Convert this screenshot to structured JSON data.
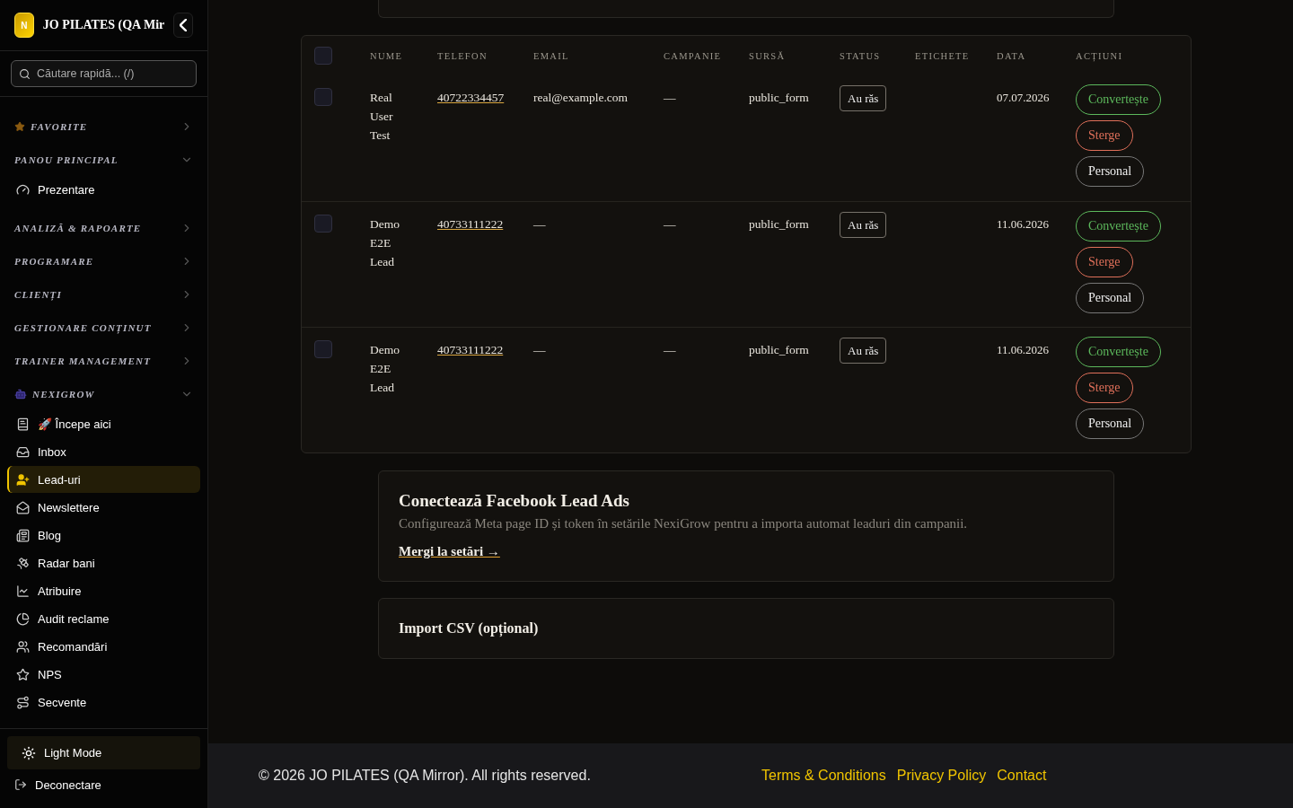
{
  "sidebar": {
    "brand": {
      "logo": "N",
      "title": "JO PILATES (QA Mir"
    },
    "search": {
      "placeholder": "Căutare rapidă... (/)"
    },
    "sections": [
      {
        "label": "FAVORITE",
        "kind": "favorite",
        "expanded": false
      },
      {
        "label": "PANOU PRINCIPAL",
        "kind": "plain",
        "expanded": true,
        "items": [
          {
            "label": "Prezentare",
            "selected": false
          }
        ]
      },
      {
        "label": "ANALIZĂ & RAPOARTE",
        "kind": "plain",
        "expanded": false
      },
      {
        "label": "PROGRAMARE",
        "kind": "plain",
        "expanded": false
      },
      {
        "label": "CLIENȚI",
        "kind": "plain",
        "expanded": false
      },
      {
        "label": "GESTIONARE CONȚINUT",
        "kind": "plain",
        "expanded": false
      },
      {
        "label": "TRAINER MANAGEMENT",
        "kind": "plain",
        "expanded": false
      },
      {
        "label": "NEXIGROW",
        "kind": "robot",
        "expanded": true,
        "items": [
          {
            "label": "🚀 Începe aici",
            "selected": false
          },
          {
            "label": "Inbox",
            "selected": false
          },
          {
            "label": "Lead-uri",
            "selected": true
          },
          {
            "label": "Newslettere",
            "selected": false
          },
          {
            "label": "Blog",
            "selected": false
          },
          {
            "label": "Radar bani",
            "selected": false
          },
          {
            "label": "Atribuire",
            "selected": false
          },
          {
            "label": "Audit reclame",
            "selected": false
          },
          {
            "label": "Recomandări",
            "selected": false
          },
          {
            "label": "NPS",
            "selected": false
          },
          {
            "label": "Secvente",
            "selected": false
          }
        ]
      }
    ],
    "theme_toggle": "Light Mode",
    "logout": "Deconectare"
  },
  "table": {
    "columns": [
      "NUME",
      "TELEFON",
      "EMAIL",
      "CAMPANIE",
      "SURSĂ",
      "STATUS",
      "ETICHETE",
      "DATA",
      "ACȚIUNI"
    ],
    "header_checked": false,
    "rows": [
      {
        "checked": false,
        "name": "Real User Test",
        "phone": "40722334457",
        "email": "real@example.com",
        "campaign": "—",
        "source": "public_form",
        "status": "Au răs",
        "date": "07.07.2026",
        "actions": [
          {
            "label": "Convertește",
            "kind": "convert"
          },
          {
            "label": "Sterge",
            "kind": "delete"
          },
          {
            "label": "Personal",
            "kind": "neutral"
          }
        ]
      },
      {
        "checked": false,
        "name": "Demo E2E Lead",
        "phone": "40733111222",
        "email": "—",
        "campaign": "—",
        "source": "public_form",
        "status": "Au răs",
        "date": "11.06.2026",
        "actions": [
          {
            "label": "Convertește",
            "kind": "convert"
          },
          {
            "label": "Sterge",
            "kind": "delete"
          },
          {
            "label": "Personal",
            "kind": "neutral"
          }
        ]
      },
      {
        "checked": false,
        "name": "Demo E2E Lead",
        "phone": "40733111222",
        "email": "—",
        "campaign": "—",
        "source": "public_form",
        "status": "Au răs",
        "date": "11.06.2026",
        "actions": [
          {
            "label": "Convertește",
            "kind": "convert"
          },
          {
            "label": "Sterge",
            "kind": "delete"
          },
          {
            "label": "Personal",
            "kind": "neutral"
          }
        ]
      }
    ]
  },
  "facebook_card": {
    "title": "Conectează Facebook Lead Ads",
    "text": "Configurează Meta page ID și token în setările NexiGrow pentru a importa automat leaduri din campanii.",
    "link": "Mergi la setări →"
  },
  "csv_card": {
    "title": "Import CSV (opțional)"
  },
  "footer": {
    "copyright": "© 2026 JO PILATES (QA Mirror). All rights reserved.",
    "links": [
      "Terms & Conditions",
      "Privacy Policy",
      "Contact"
    ]
  }
}
